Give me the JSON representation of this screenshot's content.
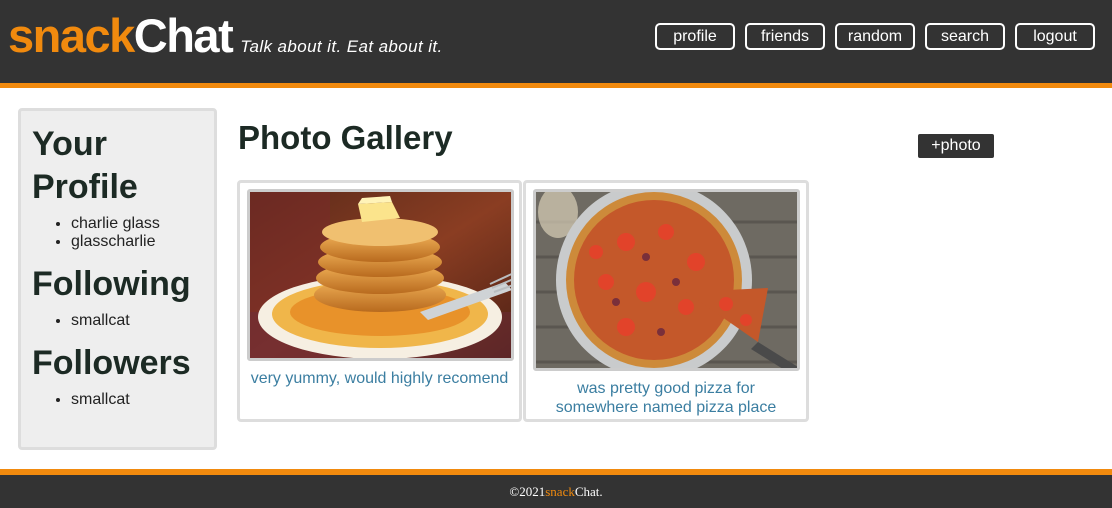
{
  "header": {
    "brand_part1": "snack",
    "brand_part2": "Chat",
    "tagline": "Talk about it. Eat about it."
  },
  "nav": {
    "profile": "profile",
    "friends": "friends",
    "random": "random",
    "search": "search",
    "logout": "logout"
  },
  "sidebar": {
    "profile_heading_1": "Your",
    "profile_heading_2": "Profile",
    "profile_items": [
      "charlie glass",
      "glasscharlie"
    ],
    "following_heading": "Following",
    "following_items": [
      "smallcat"
    ],
    "followers_heading": "Followers",
    "followers_items": [
      "smallcat"
    ]
  },
  "main": {
    "title": "Photo Gallery",
    "add_photo_label": "+photo",
    "photos": [
      {
        "caption": "very yummy, would highly recomend",
        "subject": "pancakes-photo"
      },
      {
        "caption": "was pretty good pizza for somewhere named pizza place",
        "subject": "pizza-photo"
      }
    ]
  },
  "footer": {
    "prefix": "©2021 ",
    "brand_part1": "snack",
    "brand_part2": "Chat."
  },
  "colors": {
    "accent": "#f18a0e",
    "header_bg": "#333333",
    "caption": "#3b7ea1",
    "heading": "#1c2a24"
  }
}
